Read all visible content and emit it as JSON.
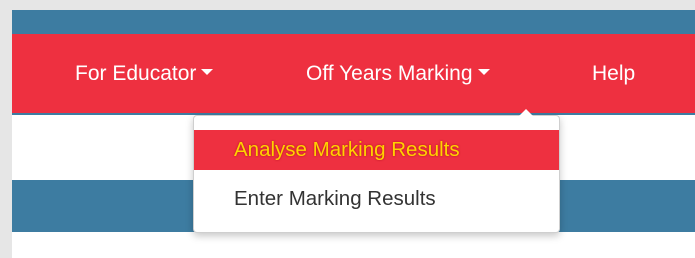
{
  "colors": {
    "navbar_bg": "#ee3040",
    "accent_blue": "#3d7ca1",
    "highlight_text": "#ffd200",
    "menu_text": "#333333"
  },
  "navbar": {
    "items": [
      {
        "label": "For Educator",
        "has_dropdown": true,
        "icon": "caret-down-icon"
      },
      {
        "label": "Off Years Marking",
        "has_dropdown": true,
        "icon": "caret-down-icon",
        "open": true
      },
      {
        "label": "Help",
        "has_dropdown": false
      }
    ]
  },
  "dropdown": {
    "items": [
      {
        "label": "Analyse Marking Results",
        "highlighted": true
      },
      {
        "label": "Enter Marking Results",
        "highlighted": false
      }
    ]
  }
}
